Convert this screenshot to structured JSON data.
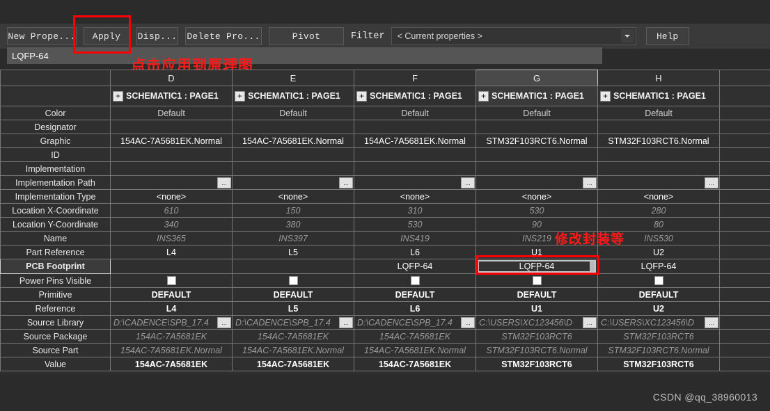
{
  "toolbar": {
    "buttons": [
      {
        "name": "new-property-button",
        "label": "New Prope..."
      },
      {
        "name": "apply-button",
        "label": "Apply"
      },
      {
        "name": "display-button",
        "label": "Disp..."
      },
      {
        "name": "delete-property-button",
        "label": "Delete Pro..."
      },
      {
        "name": "pivot-button",
        "label": "Pivot"
      }
    ],
    "filter_label": "Filter",
    "filter_value": "< Current properties >",
    "help_label": "Help"
  },
  "edit_bar": {
    "value": "LQFP-64"
  },
  "annotations": {
    "apply_note": "点击应用到原理图",
    "cell_note": "修改封装等",
    "accent_color": "#ff0000"
  },
  "grid": {
    "corner_label": "",
    "columns": [
      {
        "letter": "D",
        "page": "SCHEMATIC1 : PAGE1",
        "selected": false
      },
      {
        "letter": "E",
        "page": "SCHEMATIC1 : PAGE1",
        "selected": false
      },
      {
        "letter": "F",
        "page": "SCHEMATIC1 : PAGE1",
        "selected": false
      },
      {
        "letter": "G",
        "page": "SCHEMATIC1 : PAGE1",
        "selected": true
      },
      {
        "letter": "H",
        "page": "SCHEMATIC1 : PAGE1",
        "selected": false
      }
    ],
    "expand_icon": "+",
    "rows": [
      {
        "label": "Color",
        "style": "v-dim",
        "values": [
          "Default",
          "Default",
          "Default",
          "Default",
          "Default"
        ]
      },
      {
        "label": "Designator",
        "style": "v-normal",
        "values": [
          "",
          "",
          "",
          "",
          ""
        ]
      },
      {
        "label": "Graphic",
        "style": "v-normal",
        "values": [
          "154AC-7A5681EK.Normal",
          "154AC-7A5681EK.Normal",
          "154AC-7A5681EK.Normal",
          "STM32F103RCT6.Normal",
          "STM32F103RCT6.Normal"
        ]
      },
      {
        "label": "ID",
        "style": "hatch",
        "values": [
          "",
          "",
          "",
          "",
          ""
        ]
      },
      {
        "label": "Implementation",
        "style": "v-normal",
        "values": [
          "",
          "",
          "",
          "",
          ""
        ]
      },
      {
        "label": "Implementation Path",
        "style": "picker",
        "values": [
          "",
          "",
          "",
          "",
          ""
        ]
      },
      {
        "label": "Implementation Type",
        "style": "v-normal",
        "values": [
          "<none>",
          "<none>",
          "<none>",
          "<none>",
          "<none>"
        ]
      },
      {
        "label": "Location X-Coordinate",
        "style": "v-italic",
        "values": [
          "610",
          "150",
          "310",
          "530",
          "280"
        ]
      },
      {
        "label": "Location Y-Coordinate",
        "style": "v-italic",
        "values": [
          "340",
          "380",
          "530",
          "90",
          "80"
        ]
      },
      {
        "label": "Name",
        "style": "v-italic",
        "values": [
          "INS365",
          "INS397",
          "INS419",
          "INS219",
          "INS530"
        ]
      },
      {
        "label": "Part Reference",
        "style": "v-normal",
        "values": [
          "L4",
          "L5",
          "L6",
          "U1",
          "U2"
        ]
      },
      {
        "label": "PCB Footprint",
        "style": "v-normal",
        "active": true,
        "values": [
          "",
          "",
          "LQFP-64",
          "LQFP-64",
          "LQFP-64"
        ],
        "edited_col": 3
      },
      {
        "label": "Power Pins Visible",
        "style": "checkbox",
        "values": [
          "",
          "",
          "",
          "",
          ""
        ]
      },
      {
        "label": "Primitive",
        "style": "v-bold",
        "values": [
          "DEFAULT",
          "DEFAULT",
          "DEFAULT",
          "DEFAULT",
          "DEFAULT"
        ]
      },
      {
        "label": "Reference",
        "style": "v-bold",
        "values": [
          "L4",
          "L5",
          "L6",
          "U1",
          "U2"
        ]
      },
      {
        "label": "Source Library",
        "style": "picker-italic",
        "values": [
          "D:\\CADENCE\\SPB_17.4",
          "D:\\CADENCE\\SPB_17.4",
          "D:\\CADENCE\\SPB_17.4",
          "C:\\USERS\\XC123456\\D",
          "C:\\USERS\\XC123456\\D"
        ]
      },
      {
        "label": "Source Package",
        "style": "v-italic",
        "values": [
          "154AC-7A5681EK",
          "154AC-7A5681EK",
          "154AC-7A5681EK",
          "STM32F103RCT6",
          "STM32F103RCT6"
        ]
      },
      {
        "label": "Source Part",
        "style": "v-italic",
        "values": [
          "154AC-7A5681EK.Normal",
          "154AC-7A5681EK.Normal",
          "154AC-7A5681EK.Normal",
          "STM32F103RCT6.Normal",
          "STM32F103RCT6.Normal"
        ]
      },
      {
        "label": "Value",
        "style": "v-bold",
        "values": [
          "154AC-7A5681EK",
          "154AC-7A5681EK",
          "154AC-7A5681EK",
          "STM32F103RCT6",
          "STM32F103RCT6"
        ]
      }
    ]
  },
  "watermark": "CSDN @qq_38960013"
}
